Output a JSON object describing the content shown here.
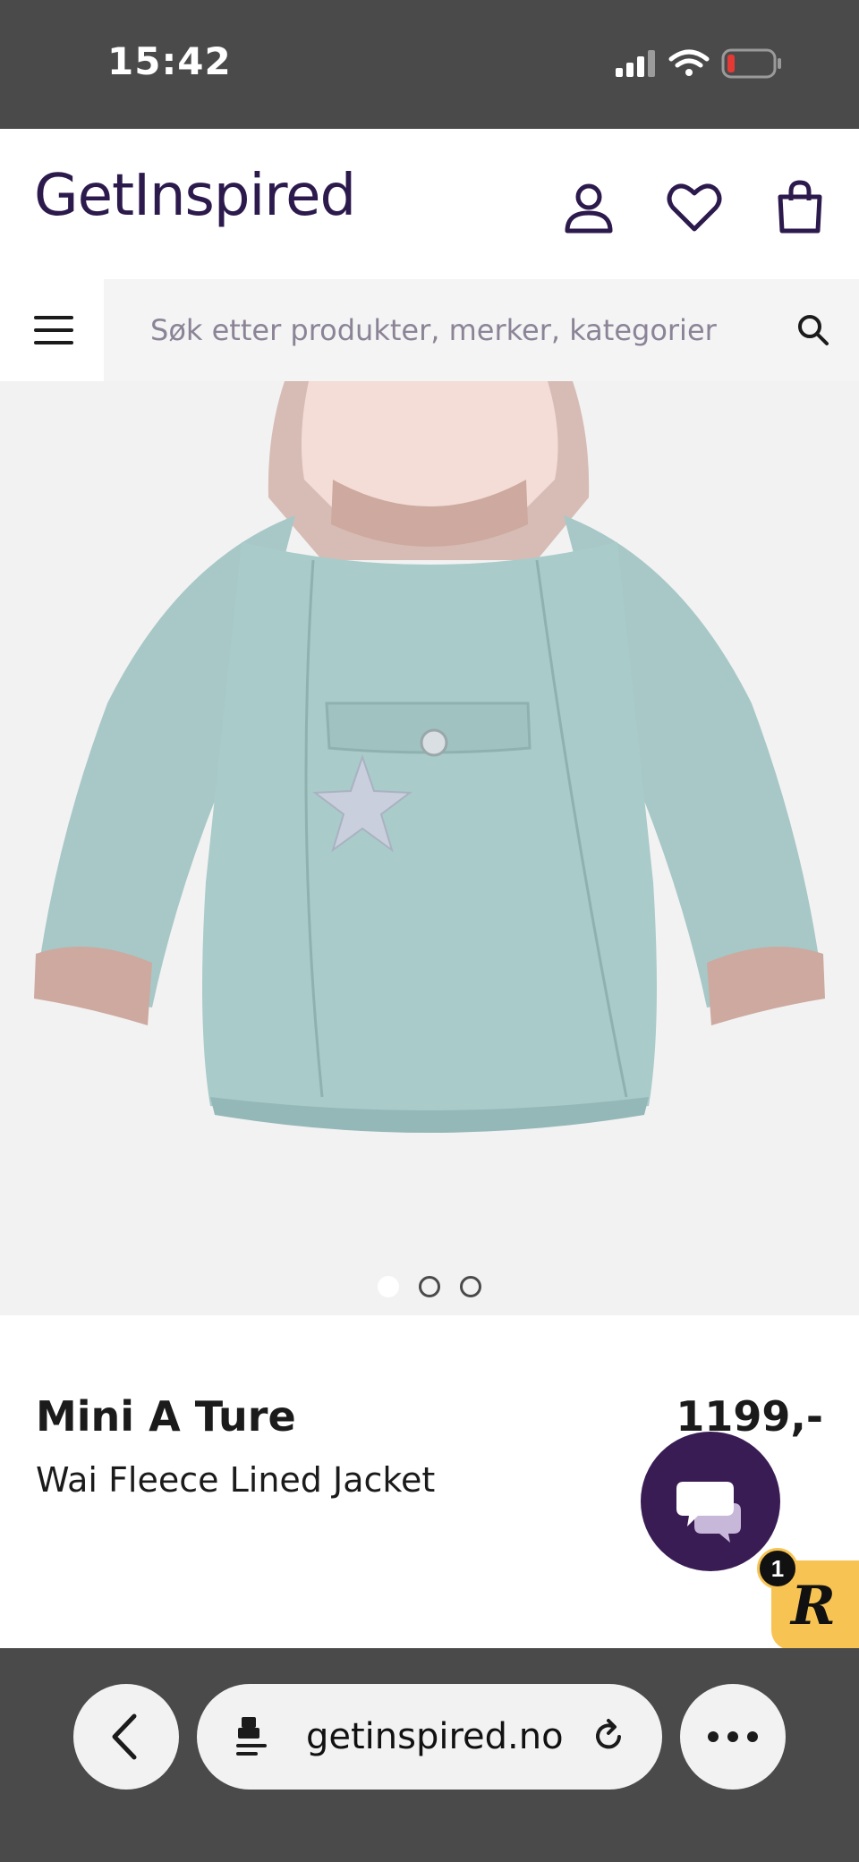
{
  "status_bar": {
    "time": "15:42",
    "icons": [
      "signal-icon",
      "wifi-icon",
      "battery-icon"
    ],
    "battery_color": "#e53935"
  },
  "header": {
    "logo": "GetInspired",
    "icons": [
      "account-icon",
      "heart-icon",
      "cart-icon"
    ],
    "brand_color": "#2c1a4d"
  },
  "search": {
    "placeholder": "Søk etter produkter, merker, kategorier",
    "menu_icon": "menu-icon",
    "search_icon": "search-icon"
  },
  "gallery": {
    "image": "product-jacket-image",
    "slide_count": 3,
    "active_slide": 1
  },
  "product": {
    "brand": "Mini A Ture",
    "name": "Wai Fleece Lined Jacket",
    "price": "1199,-"
  },
  "chat": {
    "icon": "chat-icon",
    "color": "#3a1c55"
  },
  "rewards": {
    "badge_count": "1",
    "logo_letter": "R",
    "color": "#f7c454"
  },
  "browser": {
    "url": "getinspired.no",
    "icons": [
      "back-icon",
      "page-settings-icon",
      "reload-icon",
      "more-icon"
    ]
  }
}
